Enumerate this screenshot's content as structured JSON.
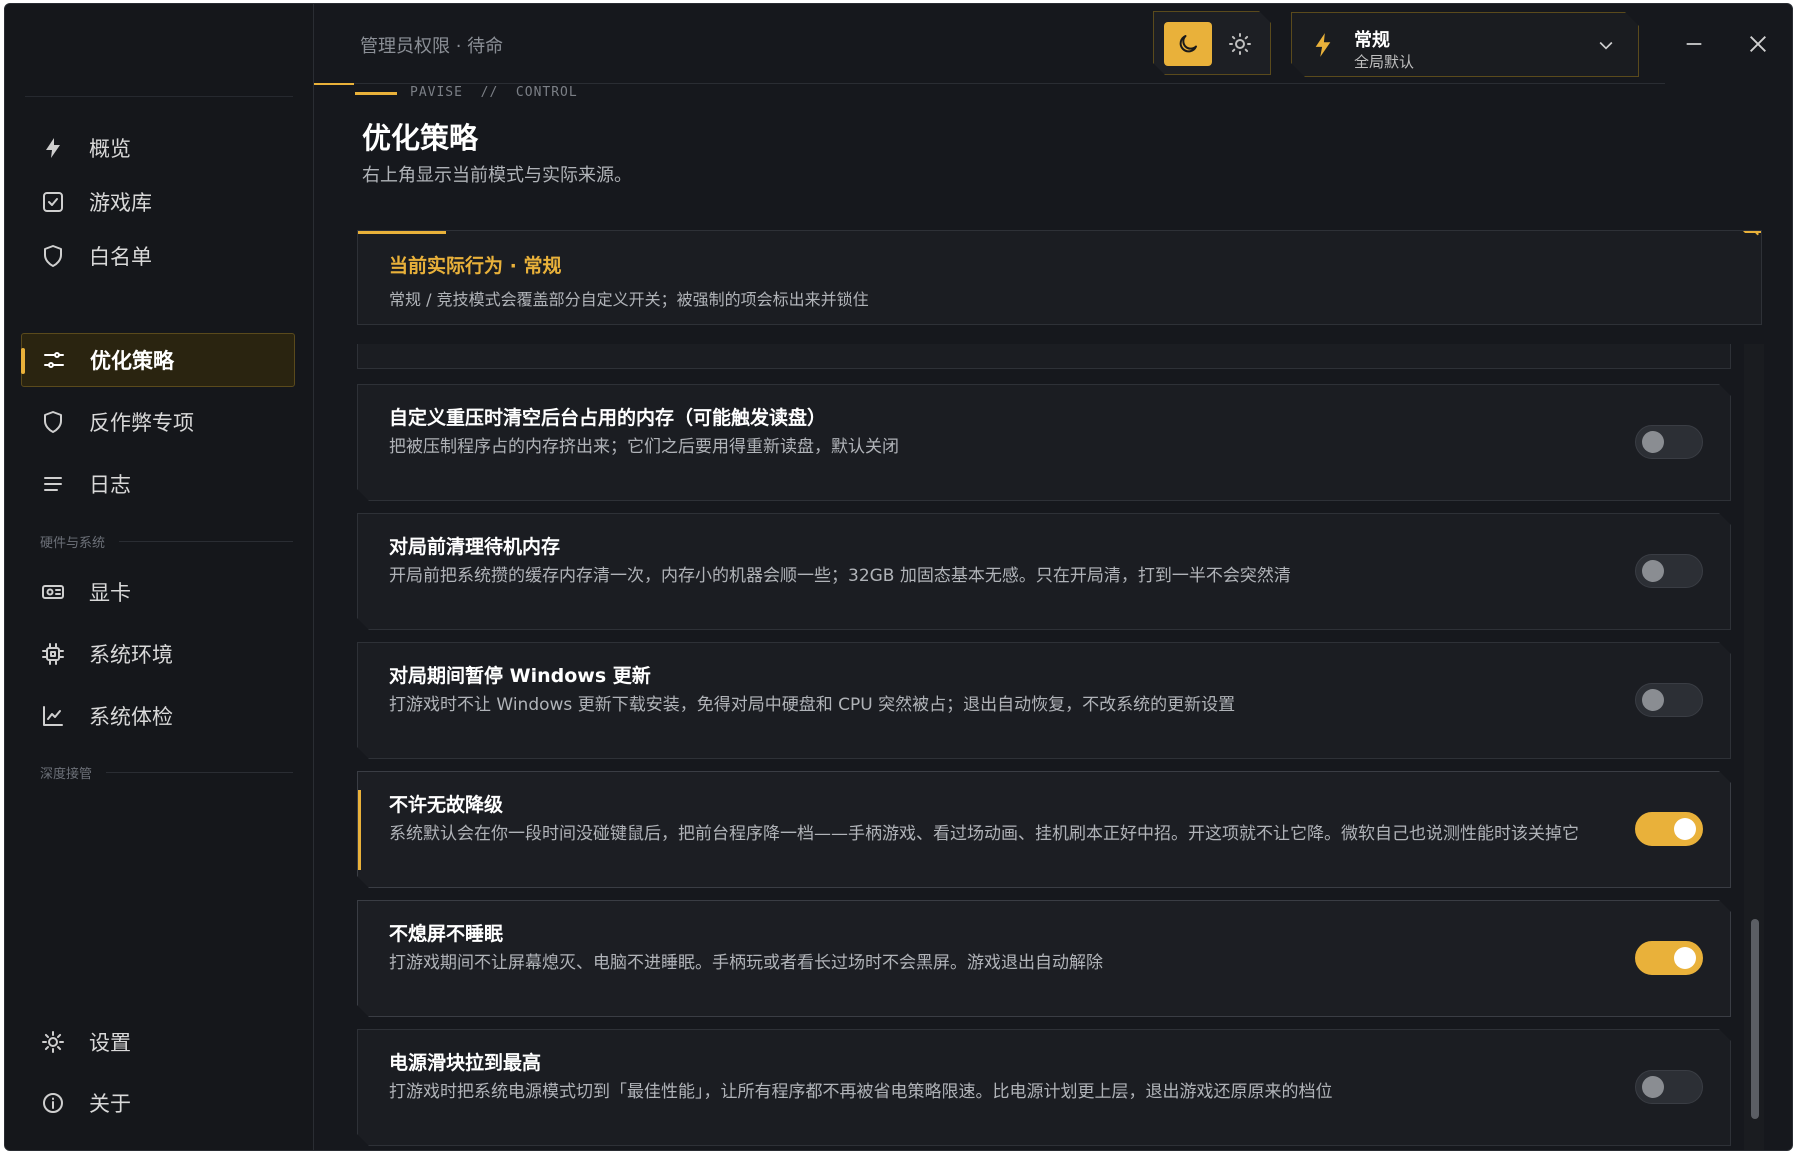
{
  "topbar": {
    "status": "管理员权限 · 待命",
    "mode_name": "常规",
    "mode_sub": "全局默认"
  },
  "header": {
    "crumb": "PAVISE  //  CONTROL",
    "title": "优化策略",
    "subtitle": "右上角显示当前模式与实际来源。"
  },
  "behavior": {
    "title": "当前实际行为 · 常规",
    "desc": "常规 / 竞技模式会覆盖部分自定义开关；被强制的项会标出来并锁住"
  },
  "sidebar": {
    "items": [
      {
        "label": "概览",
        "icon": "bolt-icon"
      },
      {
        "label": "游戏库",
        "icon": "checkbox-icon"
      },
      {
        "label": "白名单",
        "icon": "shield-icon"
      },
      {
        "label": "优化策略",
        "icon": "sliders-icon"
      },
      {
        "label": "反作弊专项",
        "icon": "shield-icon"
      },
      {
        "label": "日志",
        "icon": "list-icon"
      }
    ],
    "section_hw": "硬件与系统",
    "hw_items": [
      {
        "label": "显卡",
        "icon": "gpu-icon"
      },
      {
        "label": "系统环境",
        "icon": "chip-icon"
      },
      {
        "label": "系统体检",
        "icon": "chart-icon"
      }
    ],
    "section_deep": "深度接管",
    "bottom_items": [
      {
        "label": "设置",
        "icon": "gear-icon"
      },
      {
        "label": "关于",
        "icon": "info-icon"
      }
    ]
  },
  "options": [
    {
      "title": "自定义重压时清空后台占用的内存（可能触发读盘）",
      "desc": "把被压制程序占的内存挤出来；它们之后要用得重新读盘，默认关闭",
      "on": false
    },
    {
      "title": "对局前清理待机内存",
      "desc": "开局前把系统攒的缓存内存清一次，内存小的机器会顺一些；32GB 加固态基本无感。只在开局清，打到一半不会突然清",
      "on": false
    },
    {
      "title": "对局期间暂停 Windows 更新",
      "desc": "打游戏时不让 Windows 更新下载安装，免得对局中硬盘和 CPU 突然被占；退出自动恢复，不改系统的更新设置",
      "on": false
    },
    {
      "title": "不许无故降级",
      "desc": "系统默认会在你一段时间没碰键鼠后，把前台程序降一档——手柄游戏、看过场动画、挂机刷本正好中招。开这项就不让它降。微软自己也说测性能时该关掉它",
      "on": true
    },
    {
      "title": "不熄屏不睡眠",
      "desc": "打游戏期间不让屏幕熄灭、电脑不进睡眠。手柄玩或者看长过场时不会黑屏。游戏退出自动解除",
      "on": true
    },
    {
      "title": "电源滑块拉到最高",
      "desc": "打游戏时把系统电源模式切到「最佳性能」，让所有程序都不再被省电策略限速。比电源计划更上层，退出游戏还原原来的档位",
      "on": false
    }
  ],
  "colors": {
    "accent": "#e9b13a",
    "bg": "#16181d",
    "card": "#1b1d22"
  }
}
